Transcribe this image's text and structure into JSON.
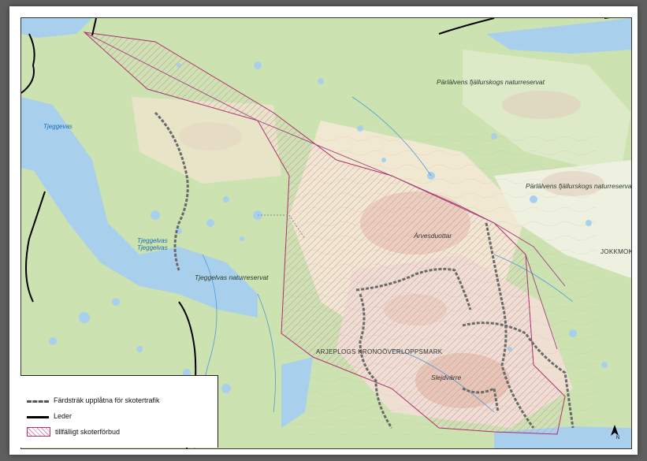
{
  "map": {
    "labels": {
      "reserve_1": "Pärlälvens fjällurskogs naturreservat",
      "reserve_2": "Pärlälvens fjällurskogs naturreservat",
      "reserve_3": "Tjeggelvas naturreservat",
      "lake_name": "Tjeggelvas",
      "lake_name_2": "Tjeggelvas",
      "lake_tjeggevas": "Tjeggevas",
      "mountain_1": "Árvesduottar",
      "mountain_2": "Slejdvárre",
      "area_1": "ARJEPLOGS KRONOÖVERLOPPSMARK",
      "area_2": "JOKKMOKKS KRON"
    },
    "colors": {
      "forest": "#cfe3b4",
      "open_land": "#f3ecd6",
      "mountain": "#e9cfc0",
      "water": "#a9d1ec",
      "snowmobile_area": "#b03070",
      "trail": "#000000",
      "route": "#555555"
    }
  },
  "legend": {
    "items": [
      {
        "label": "Färdsträk upplåtna för skotertrafik",
        "symbol": "dashed-gray-line"
      },
      {
        "label": "Leder",
        "symbol": "solid-black-line"
      },
      {
        "label": "tillfälligt skoterförbud",
        "symbol": "pink-hatched-area"
      }
    ]
  },
  "north_arrow": {
    "label": "N"
  }
}
